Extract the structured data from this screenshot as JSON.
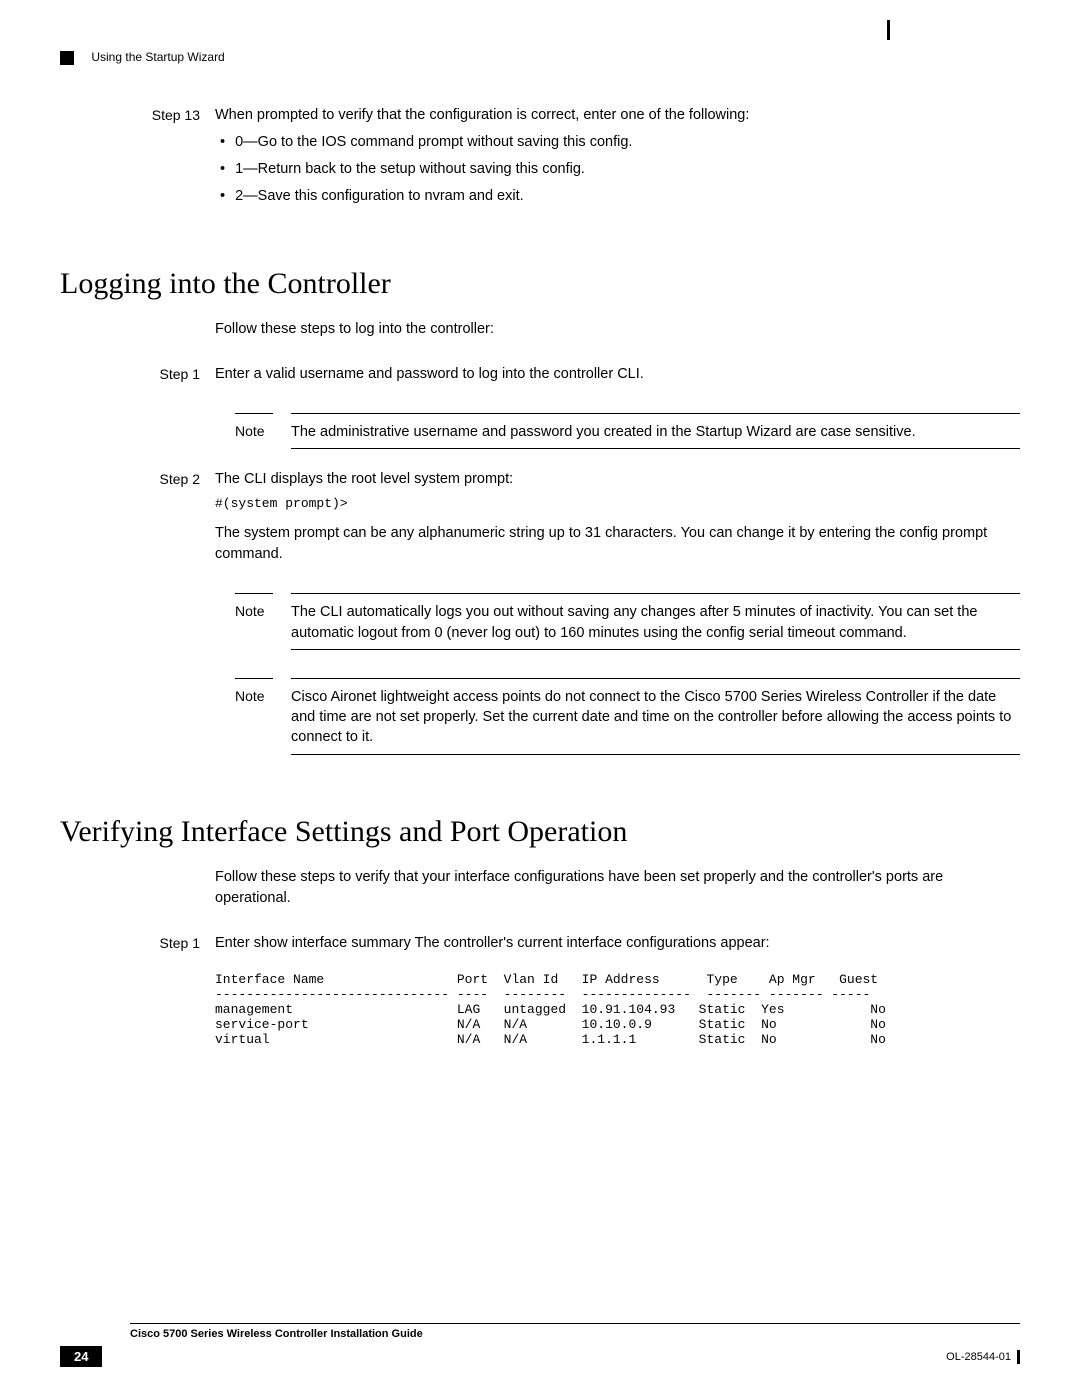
{
  "header": {
    "running_title": "Using the Startup Wizard"
  },
  "section_a": {
    "step13_label": "Step 13",
    "step13_text": "When prompted to verify that the configuration is correct, enter one of the following:",
    "bullets": [
      "0—Go to the IOS command prompt without saving this config.",
      "1—Return back to the setup without saving this config.",
      "2—Save this configuration to nvram and exit."
    ]
  },
  "section_b": {
    "heading": "Logging into the Controller",
    "intro": "Follow these steps to log into the controller:",
    "step1_label": "Step 1",
    "step1_text": "Enter a valid username and password to log into the controller CLI.",
    "note1_label": "Note",
    "note1_text": "The administrative username and password you created in the Startup Wizard are case sensitive.",
    "step2_label": "Step 2",
    "step2_text": "The CLI displays the root level system prompt:",
    "prompt": "#(system prompt)>",
    "step2_para_a": "The system prompt can be any alphanumeric string up to 31 characters. You can change it by entering the ",
    "step2_cmd": "config prompt",
    "step2_para_b": " command.",
    "note2_label": "Note",
    "note2_text_a": "The CLI automatically logs you out without saving any changes after 5 minutes of inactivity. You can set the automatic logout from 0 (never log out) to 160 minutes using the ",
    "note2_cmd": "config serial timeout",
    "note2_text_b": " command.",
    "note3_label": "Note",
    "note3_text": "Cisco Aironet lightweight access points do not connect to the Cisco 5700 Series Wireless Controller if the date and time are not set properly. Set the current date and time on the controller before allowing the access points to connect to it."
  },
  "section_c": {
    "heading": "Verifying Interface Settings and Port Operation",
    "intro": "Follow these steps to verify that your interface configurations have been set properly and the controller's ports are operational.",
    "step1_label": "Step 1",
    "step1_text_a": "Enter ",
    "step1_cmd": "show interface summary",
    "step1_text_b": " The controller's current interface configurations appear:",
    "table": "Interface Name                 Port  Vlan Id   IP Address      Type    Ap Mgr   Guest\n------------------------------ ----  --------  --------------  ------- ------- -----\nmanagement                     LAG   untagged  10.91.104.93   Static  Yes           No\nservice-port                   N/A   N/A       10.10.0.9      Static  No            No\nvirtual                        N/A   N/A       1.1.1.1        Static  No            No"
  },
  "footer": {
    "doc_title": "Cisco 5700 Series Wireless Controller Installation Guide",
    "page_num": "24",
    "doc_id": "OL-28544-01"
  }
}
